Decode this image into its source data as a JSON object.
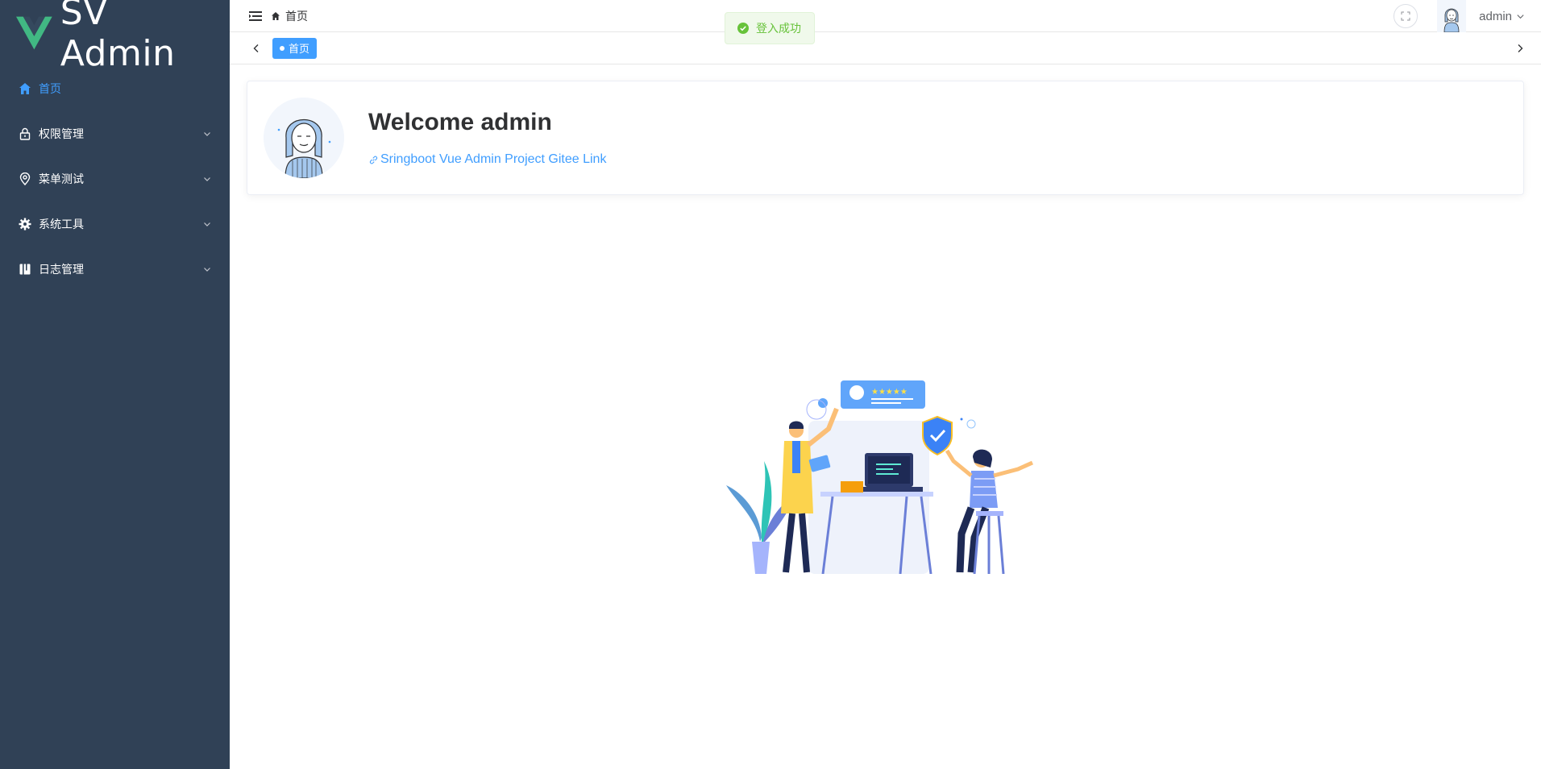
{
  "sidebar": {
    "logo_text": "SV Admin",
    "items": [
      {
        "label": "首页",
        "icon": "home-icon",
        "active": true
      },
      {
        "label": "权限管理",
        "icon": "lock-icon"
      },
      {
        "label": "菜单测试",
        "icon": "location-icon"
      },
      {
        "label": "系统工具",
        "icon": "gear-icon"
      },
      {
        "label": "日志管理",
        "icon": "log-icon"
      }
    ]
  },
  "navbar": {
    "breadcrumb": "首页",
    "username": "admin"
  },
  "tags": {
    "items": [
      {
        "label": "首页"
      }
    ]
  },
  "toast": {
    "message": "登入成功"
  },
  "welcome": {
    "title": "Welcome admin",
    "link_text": "Sringboot Vue Admin Project Gitee Link"
  },
  "colors": {
    "sidebar_bg": "#304156",
    "accent": "#409eff",
    "success": "#67c23a"
  }
}
